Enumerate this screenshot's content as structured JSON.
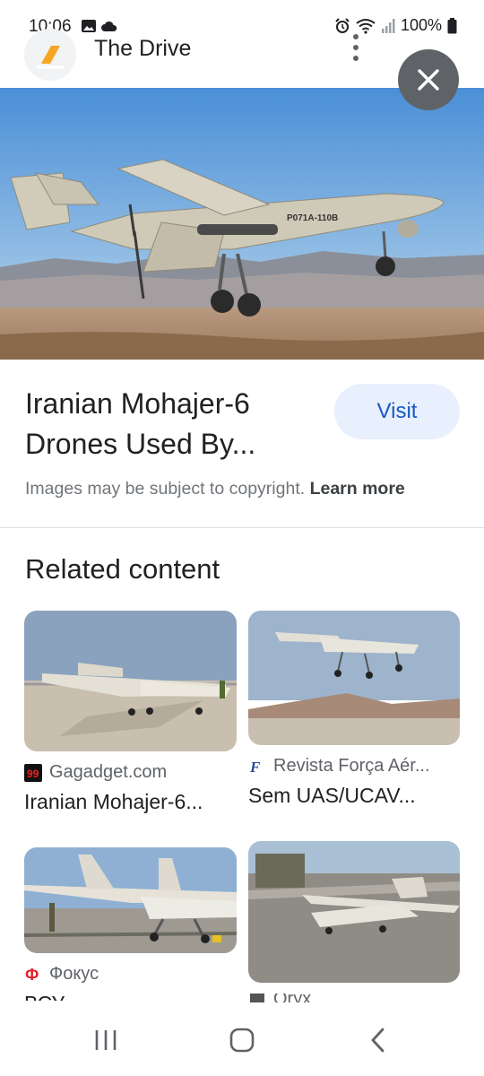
{
  "status_bar": {
    "time": "10:06",
    "battery": "100%"
  },
  "header": {
    "site_name": "The Drive",
    "logo_icon": "the-drive-logo",
    "menu_icon": "more-vert-icon",
    "close_icon": "close-icon"
  },
  "result": {
    "title_line1": "Iranian Mohajer-6",
    "title_line2": "Drones Used By...",
    "visit_label": "Visit",
    "copyright_text": "Images may be subject to copyright.",
    "learn_more": "Learn more",
    "image_label": "P071A-110B"
  },
  "related": {
    "heading": "Related content",
    "items": [
      {
        "source": "Gagadget.com",
        "title": "Iranian Mohajer-6...",
        "favicon": "gagadget-icon"
      },
      {
        "source": "Revista Força Aér...",
        "title": "Sem UAS/UCAV...",
        "favicon": "revista-icon"
      },
      {
        "source": "Фокус",
        "title": "ВСУ",
        "favicon": "fokus-icon"
      },
      {
        "source": "Oryx",
        "title": "",
        "favicon": "oryx-icon"
      }
    ]
  },
  "nav": {
    "recents_icon": "recents-icon",
    "home_icon": "home-icon",
    "back_icon": "back-icon"
  },
  "colors": {
    "accent": "#1a56c4",
    "visit_bg": "#e8f0fe",
    "close_bg": "#5f6368"
  }
}
